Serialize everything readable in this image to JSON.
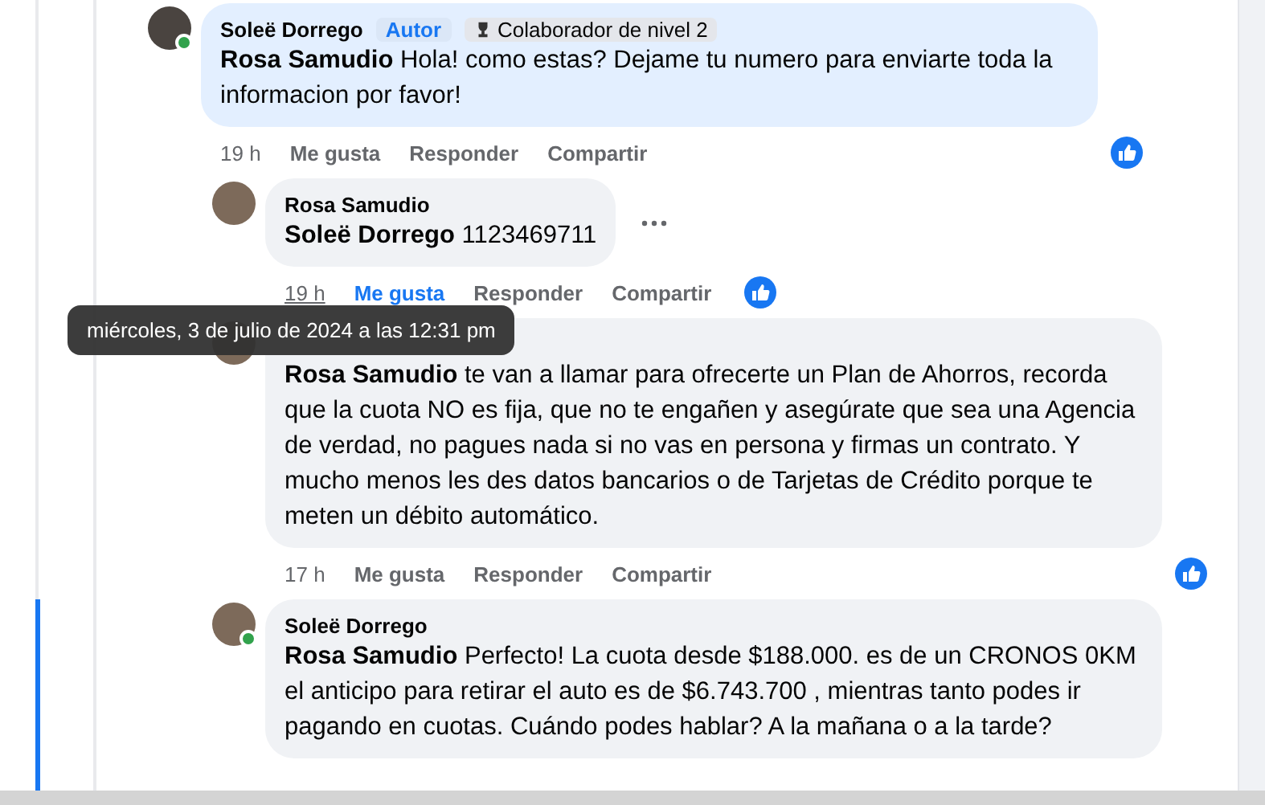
{
  "comment": {
    "author": "Soleë Dorrego",
    "badges": [
      {
        "kind": "author",
        "label": "Autor"
      },
      {
        "kind": "level",
        "label": "Colaborador de nivel 2"
      }
    ],
    "mention": "Rosa Samudio",
    "text": "Hola! como estas? Dejame tu numero para enviarte toda la informacion por favor!",
    "time": "19 h",
    "hovered": false,
    "online": true,
    "highlighted": true,
    "liked": false,
    "more": false,
    "like_reaction": true,
    "actions": [
      "Me gusta",
      "Responder",
      "Compartir"
    ],
    "replies": [
      {
        "author": "Rosa Samudio",
        "mention": "Soleë Dorrego",
        "text": "1123469711",
        "time": "19 h",
        "hovered": true,
        "online": false,
        "highlighted": false,
        "liked": true,
        "more": true,
        "like_reaction": true,
        "actions": [
          "Me gusta",
          "Responder",
          "Compartir"
        ]
      },
      {
        "mention": "Rosa Samudio",
        "text": "te van a llamar para ofrecerte un Plan de Ahorros, recorda que la cuota NO es fija, que no te engañen y asegúrate que sea una Agencia de verdad, no pagues nada si no vas en persona y firmas un contrato. Y mucho menos les des datos bancarios o de Tarjetas de Crédito porque te meten un débito automático.",
        "time": "17 h",
        "hovered": false,
        "online": false,
        "highlighted": false,
        "liked": false,
        "more": false,
        "like_reaction": true,
        "actions": [
          "Me gusta",
          "Responder",
          "Compartir"
        ]
      },
      {
        "author": "Soleë Dorrego",
        "mention": "Rosa Samudio",
        "text": "Perfecto! La cuota desde $188.000. es de un CRONOS 0KM el anticipo para retirar el auto es de $6.743.700 , mientras tanto podes ir pagando en cuotas. Cuándo podes hablar? A la mañana o a la tarde?",
        "online": true,
        "highlighted": false,
        "more": false
      }
    ]
  },
  "tooltip": {
    "text": "miércoles, 3 de julio de 2024 a las 12:31 pm"
  }
}
